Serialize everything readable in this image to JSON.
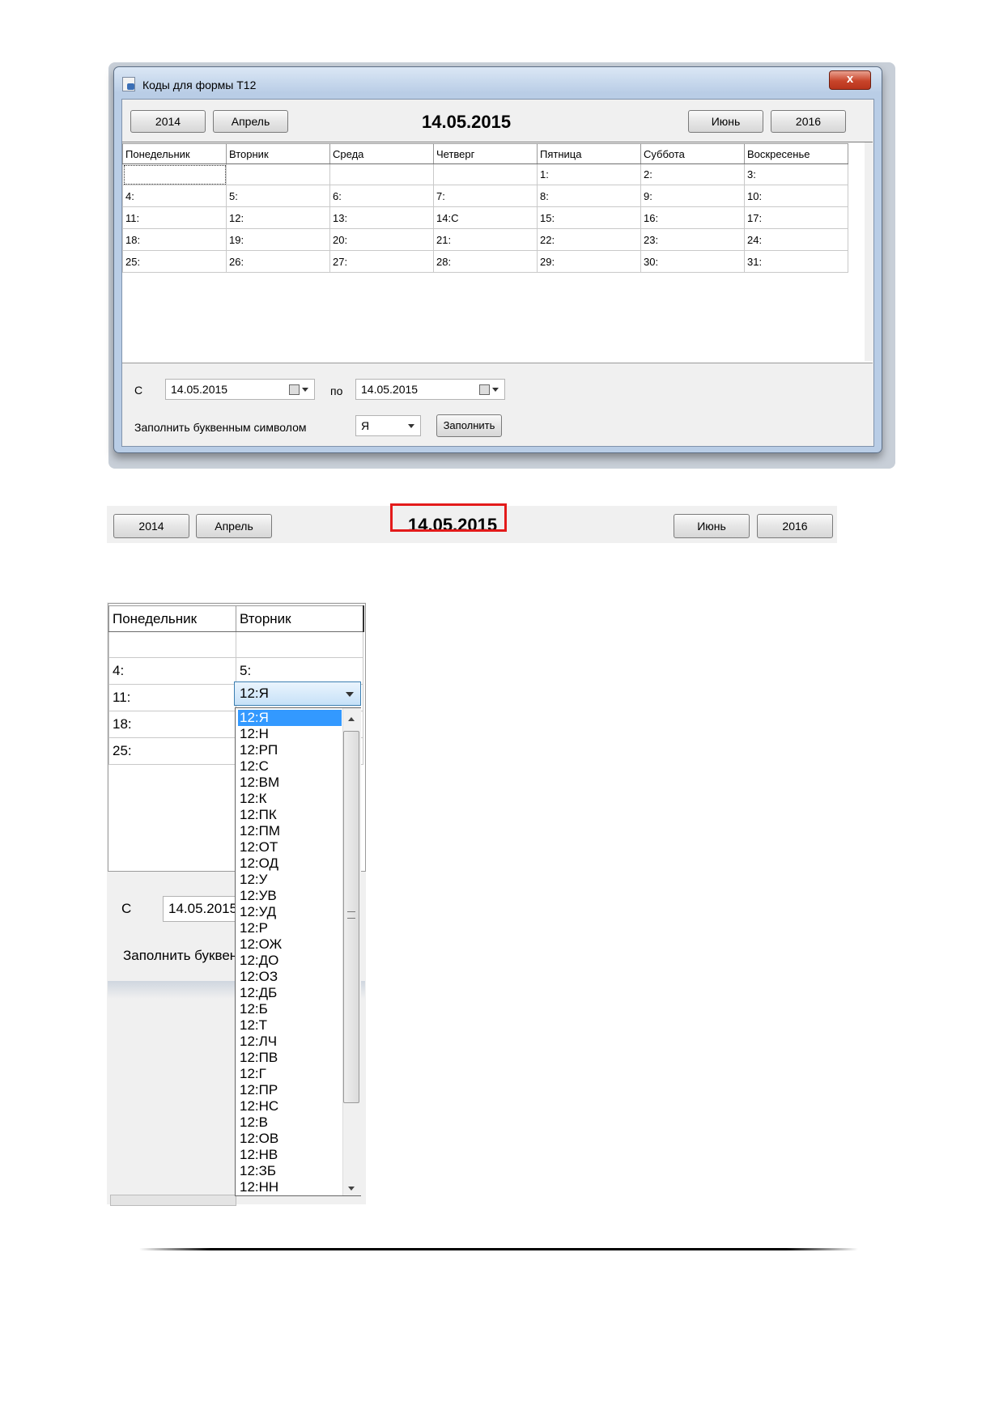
{
  "window": {
    "title": "Коды для формы Т12",
    "close_label": "x",
    "prev_year": "2014",
    "prev_month": "Апрель",
    "current_date": "14.05.2015",
    "next_month": "Июнь",
    "next_year": "2016"
  },
  "weekdays": [
    "Понедельник",
    "Вторник",
    "Среда",
    "Четверг",
    "Пятница",
    "Суббота",
    "Воскресенье"
  ],
  "calendar_rows": [
    [
      "",
      "",
      "",
      "",
      "1:",
      "2:",
      "3:"
    ],
    [
      "4:",
      "5:",
      "6:",
      "7:",
      "8:",
      "9:",
      "10:"
    ],
    [
      "11:",
      "12:",
      "13:",
      "14:С",
      "15:",
      "16:",
      "17:"
    ],
    [
      "18:",
      "19:",
      "20:",
      "21:",
      "22:",
      "23:",
      "24:"
    ],
    [
      "25:",
      "26:",
      "27:",
      "28:",
      "29:",
      "30:",
      "31:"
    ]
  ],
  "range": {
    "from_label": "С",
    "from_value": "14.05.2015",
    "to_label": "по",
    "to_value": "14.05.2015"
  },
  "fill": {
    "label": "Заполнить буквенным символом",
    "symbol_value": "Я",
    "button_label": "Заполнить"
  },
  "zoom": {
    "headers": [
      "Понедельник",
      "Вторник"
    ],
    "rows": [
      [
        "",
        ""
      ],
      [
        "4:",
        "5:"
      ],
      [
        "11:",
        "12:Я"
      ],
      [
        "18:",
        ""
      ],
      [
        "25:",
        ""
      ]
    ],
    "combo_value": "12:Я",
    "from_label": "С",
    "from_value": "14.05.2015",
    "fill_label_partial": "Заполнить буквен",
    "options": [
      "12:Я",
      "12:Н",
      "12:РП",
      "12:С",
      "12:ВМ",
      "12:К",
      "12:ПК",
      "12:ПМ",
      "12:ОТ",
      "12:ОД",
      "12:У",
      "12:УВ",
      "12:УД",
      "12:Р",
      "12:ОЖ",
      "12:ДО",
      "12:ОЗ",
      "12:ДБ",
      "12:Б",
      "12:Т",
      "12:ЛЧ",
      "12:ПВ",
      "12:Г",
      "12:ПР",
      "12:НС",
      "12:В",
      "12:ОВ",
      "12:НВ",
      "12:ЗБ",
      "12:НН"
    ]
  }
}
